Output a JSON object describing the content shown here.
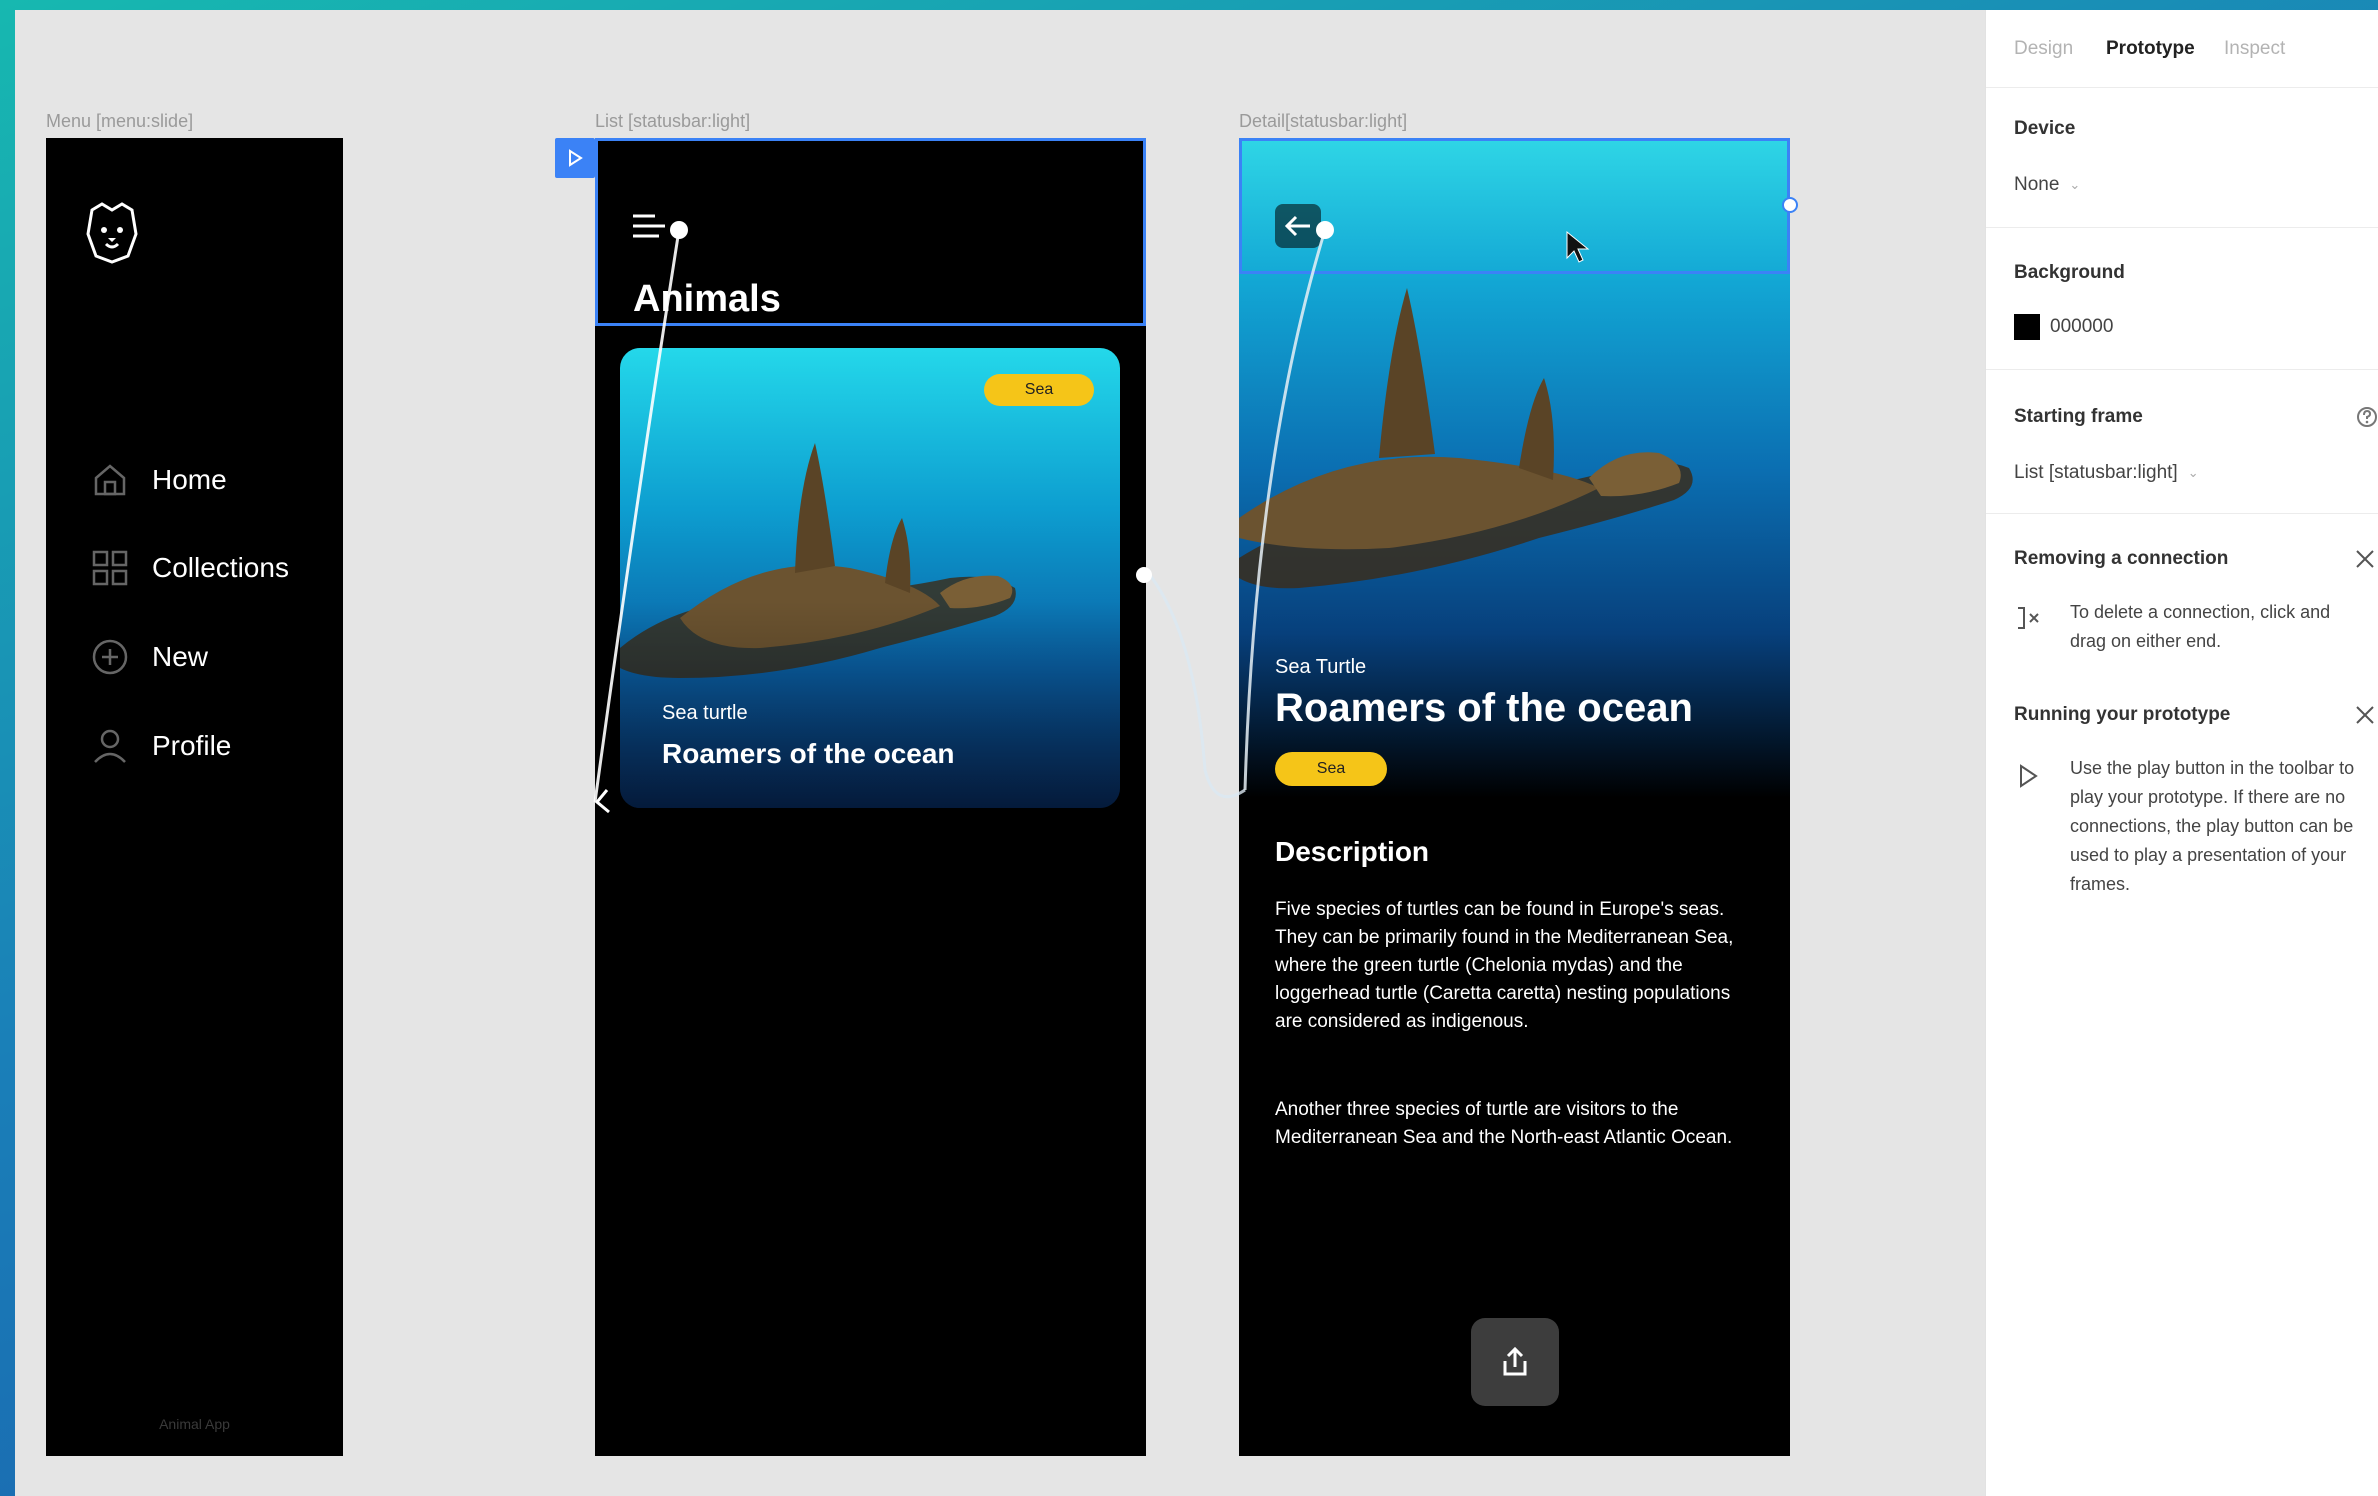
{
  "canvas": {
    "frames": {
      "menu": {
        "label": "Menu [menu:slide]",
        "items": [
          {
            "label": "Home",
            "icon": "home-icon"
          },
          {
            "label": "Collections",
            "icon": "grid-icon"
          },
          {
            "label": "New",
            "icon": "plus-circle-icon"
          },
          {
            "label": "Profile",
            "icon": "user-icon"
          }
        ],
        "footer": "Animal App"
      },
      "list": {
        "label": "List [statusbar:light]",
        "title": "Animals",
        "card": {
          "badge": "Sea",
          "subtitle": "Sea turtle",
          "title": "Roamers of the ocean"
        }
      },
      "detail": {
        "label": "Detail[statusbar:light]",
        "subtitle": "Sea Turtle",
        "title": "Roamers of the ocean",
        "badge": "Sea",
        "description_heading": "Description",
        "paragraph1": "Five species of turtles can be found in Europe's seas. They can be primarily found in the Mediterranean Sea, where the green turtle (Chelonia mydas) and the loggerhead turtle (Caretta caretta) nesting populations are considered as indigenous.",
        "paragraph2": "Another three species of turtle are visitors to the Mediterranean Sea and the North-east Atlantic Ocean."
      }
    }
  },
  "panel": {
    "tabs": {
      "design": "Design",
      "prototype": "Prototype",
      "inspect": "Inspect"
    },
    "device": {
      "title": "Device",
      "value": "None"
    },
    "background": {
      "title": "Background",
      "value": "000000",
      "color": "#000000"
    },
    "starting_frame": {
      "title": "Starting frame",
      "value": "List [statusbar:light]"
    },
    "removing": {
      "title": "Removing a connection",
      "text": "To delete a connection, click and drag on either end."
    },
    "running": {
      "title": "Running your prototype",
      "text": "Use the play button in the toolbar to play your prototype. If there are no connections, the play button can be used to play a presentation of your frames."
    }
  },
  "colors": {
    "accent": "#3b82f6",
    "badge": "#f5c518",
    "frame_bg": "#000000"
  }
}
